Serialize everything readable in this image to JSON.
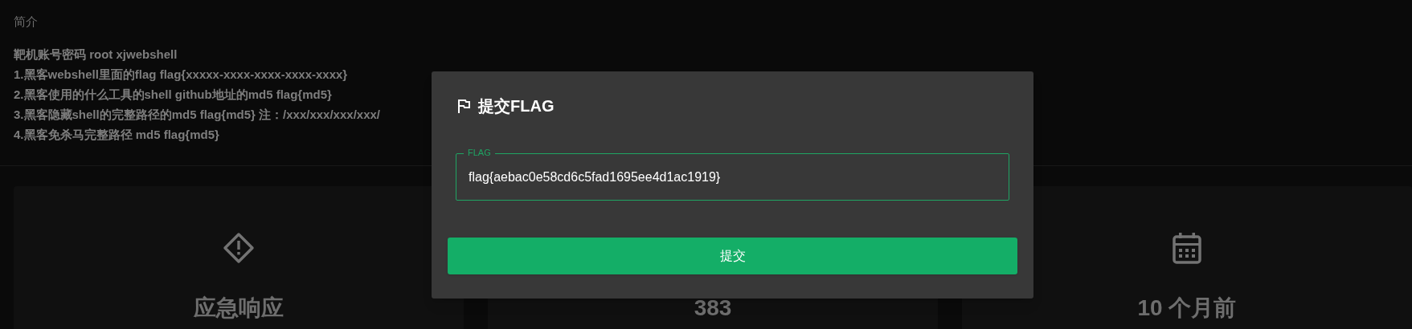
{
  "intro": {
    "heading": "简介",
    "lines": [
      "靶机账号密码 root xjwebshell",
      "1.黑客webshell里面的flag flag{xxxxx-xxxx-xxxx-xxxx-xxxx}",
      "2.黑客使用的什么工具的shell github地址的md5 flag{md5}",
      "3.黑客隐藏shell的完整路径的md5 flag{md5} 注：/xxx/xxx/xxx/xxx/",
      "4.黑客免杀马完整路径 md5 flag{md5}"
    ]
  },
  "cards": [
    {
      "kind": "warning",
      "value": "应急响应"
    },
    {
      "kind": "hidden",
      "value": "383"
    },
    {
      "kind": "calendar",
      "value": "10 个月前"
    }
  ],
  "dialog": {
    "title": "提交FLAG",
    "field": {
      "label": "FLAG",
      "value": "flag{aebac0e58cd6c5fad1695ee4d1ac1919}"
    },
    "submit": "提交"
  }
}
